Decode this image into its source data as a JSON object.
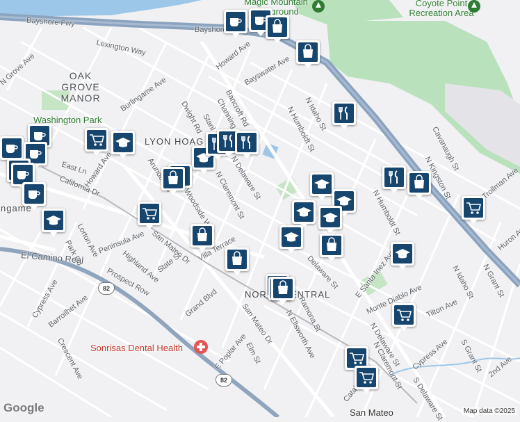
{
  "map": {
    "labels": {
      "bayshore_fwy_1": "Bayshore Fwy",
      "bayshore_fwy_2": "Bayshore Fw",
      "magic_mountain": "Magic Mountain Playground",
      "coyote_point": "Coyote Point Recreation Area",
      "oak_grove_manor": "OAK GROVE MANOR",
      "washington_park": "Washington Park",
      "lyon_hoag": "LYON HOAG",
      "north_central": "NORTH CENTRAL",
      "burlingame": "Burlingame",
      "sonrisas": "Sonrisas Dental Health",
      "san_mateo_station": "San Mateo",
      "hwy_82": "82",
      "lexington_way": "Lexington Way",
      "howard_ave_top": "Howard Ave",
      "bayswater_ave": "Bayswater Ave",
      "bancroft_rd": "Bancroft Rd",
      "channing_rd": "Channing Rd",
      "stanley_rd": "Stanl",
      "burlingame_ave": "Burlingame Ave",
      "dwight_rd": "Dwight Rd",
      "n_idaho_st": "N Idaho St",
      "n_humboldt_st": "N Humboldt St",
      "n_delaware_st": "N Delaware St",
      "n_claremont_st": "N Claremont St",
      "howard_ave": "Howard Ave",
      "east_ln": "East Ln",
      "california_dr": "California Dr",
      "arundel_rd": "Arundel Rd",
      "woodside_way": "Woodside Way",
      "peninsula_ave": "Peninsula Ave",
      "san_mateo_dr": "San Mateo Dr",
      "lorton_ave": "Lorton Ave",
      "park_rd": "Park Rd",
      "highland_ave": "Highland Ave",
      "state_st": "State St",
      "villa_terrace": "Villa Terrace",
      "el_camino_real": "El Camino Real",
      "prospect_row": "Prospect Row",
      "cypress_ave": "Cypress Ave",
      "barroilhet_ave": "Barroilhet Ave",
      "grand_blvd": "Grand Blvd",
      "san_mateo_dr2": "San Mateo Dr",
      "e_poplar_ave": "E Poplar Ave",
      "elm_st": "Elm St",
      "n_ellsworth_ave": "N Ellsworth Ave",
      "ramona_st": "Ramona St",
      "delaware_st": "Delaware St",
      "e_santa_inez_ave": "E Santa Inez Ave",
      "monte_diablo_ave": "Monte Diablo Ave",
      "n_delaware_st2": "N Delaware St",
      "s_delaware_st": "S Delaware St",
      "n_claremont_st2": "N Claremont St",
      "tilton_ave": "Tilton Ave",
      "catalpa_ave": "Catalpa Ave",
      "crescent_ave": "Crescent Ave",
      "kingston_st": "N Kingston St",
      "cavanaugh_st": "Cavanaugh St",
      "trollman_ave": "Trollman Ave",
      "huron_ave": "Huron Ave",
      "n_grant_st": "N Grant St",
      "s_grant_st": "S Grant St",
      "second_ave": "2nd Ave",
      "cypress_ave2": "Cypress Ave",
      "n_grove_ave": "N Grove Ave",
      "n_idaho_st2": "N Idaho St",
      "n_humboldt_st2": "N Humboldt St"
    },
    "attribution": "Map data ©2025",
    "logo": "Google"
  },
  "poi_icons": {
    "coffee": "coffee-cup-icon",
    "shopping": "shopping-bag-icon",
    "education": "graduation-cap-icon",
    "restaurant": "fork-knife-icon",
    "grocery": "shopping-cart-icon",
    "pin_color": "#16456e"
  }
}
